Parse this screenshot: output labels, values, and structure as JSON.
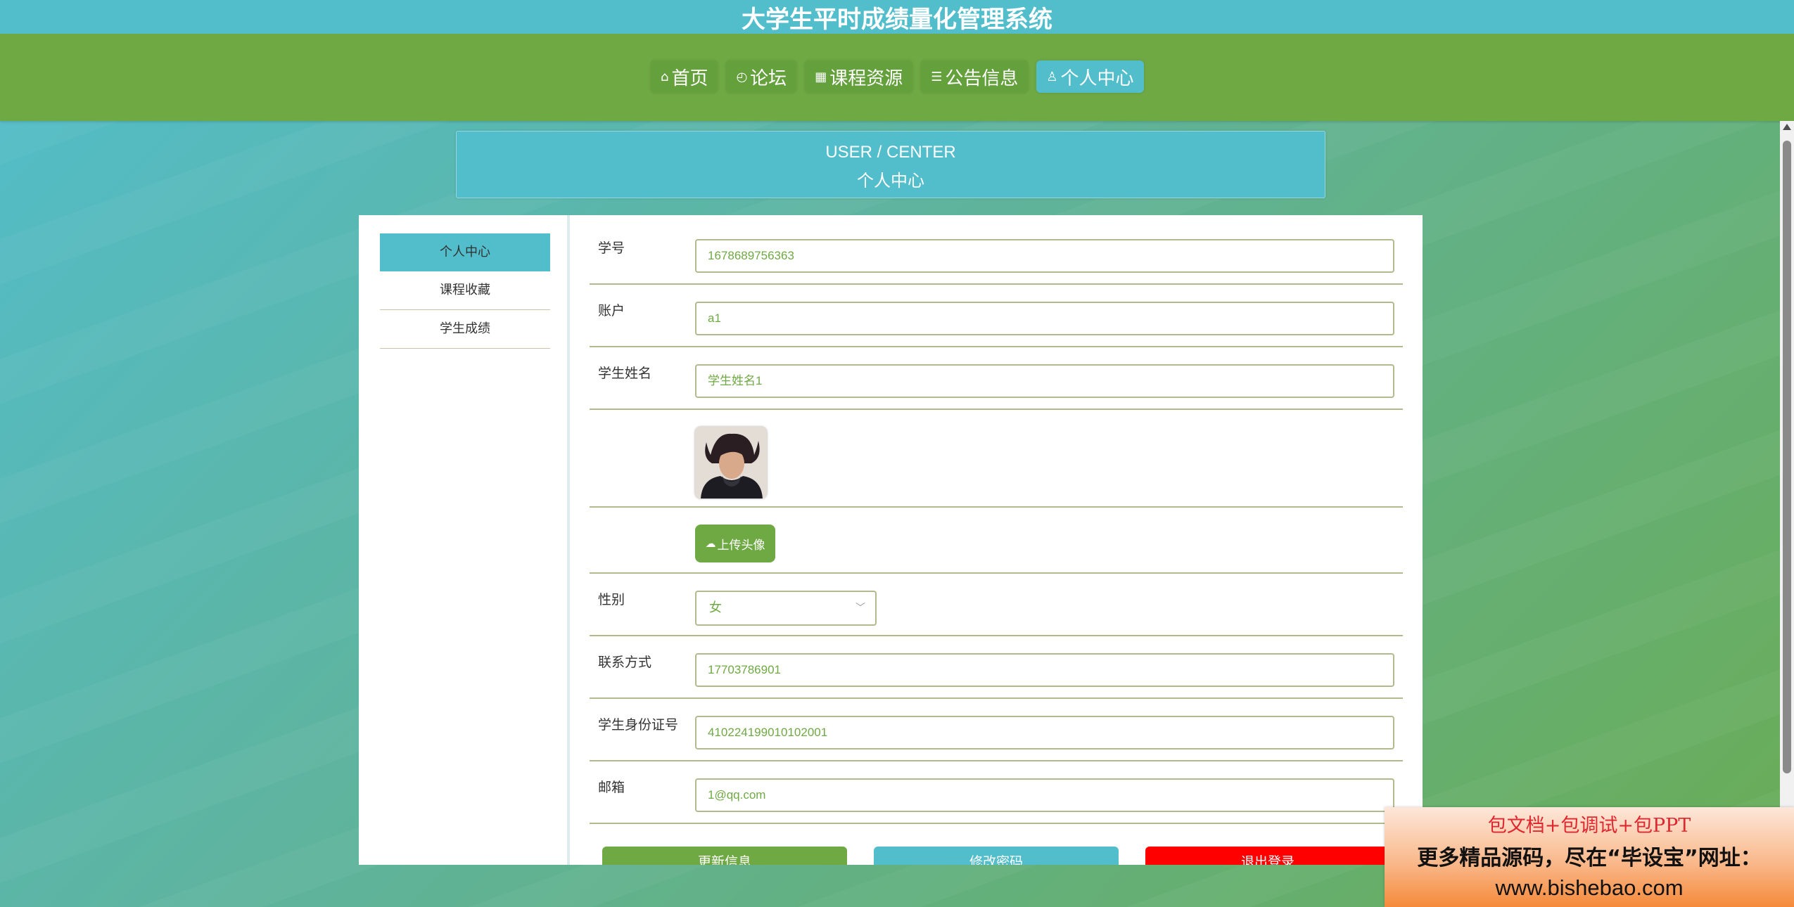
{
  "app_title": "大学生平时成绩量化管理系统",
  "nav": {
    "items": [
      {
        "label": "首页",
        "icon": "home-icon"
      },
      {
        "label": "论坛",
        "icon": "clock-icon"
      },
      {
        "label": "课程资源",
        "icon": "table-icon"
      },
      {
        "label": "公告信息",
        "icon": "layers-icon"
      },
      {
        "label": "个人中心",
        "icon": "user-icon",
        "active": true
      }
    ]
  },
  "page_header": {
    "en": "USER / CENTER",
    "zh": "个人中心"
  },
  "sidebar": {
    "items": [
      {
        "label": "个人中心",
        "active": true
      },
      {
        "label": "课程收藏"
      },
      {
        "label": "学生成绩"
      }
    ]
  },
  "form": {
    "student_id": {
      "label": "学号",
      "value": "1678689756363"
    },
    "account": {
      "label": "账户",
      "value": "a1"
    },
    "student_name": {
      "label": "学生姓名",
      "value": "学生姓名1"
    },
    "upload_avatar_label": "上传头像",
    "gender": {
      "label": "性别",
      "value": "女"
    },
    "phone": {
      "label": "联系方式",
      "value": "17703786901"
    },
    "id_card": {
      "label": "学生身份证号",
      "value": "410224199010102001"
    },
    "email": {
      "label": "邮箱",
      "value": "1@qq.com"
    }
  },
  "buttons": {
    "update": "更新信息",
    "change_password": "修改密码",
    "logout": "退出登录"
  },
  "ad": {
    "line1": "包文档+包调试+包PPT",
    "line2": "更多精品源码，尽在“毕设宝”网址：",
    "line3": "www.bishebao.com"
  },
  "colors": {
    "teal": "#52bdcb",
    "green": "#6fa944",
    "danger": "#ff0000"
  }
}
